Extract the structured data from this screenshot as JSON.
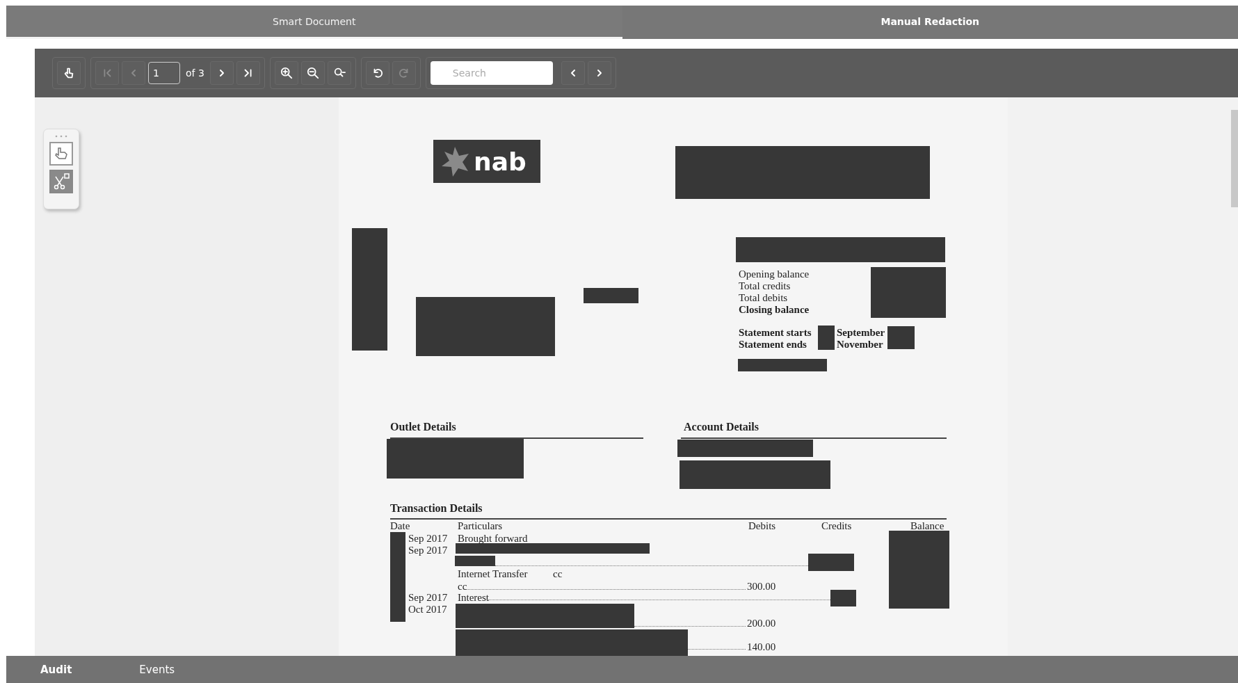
{
  "tabs": [
    {
      "label": "Smart Document",
      "selected": false
    },
    {
      "label": "Manual Redaction",
      "selected": true
    }
  ],
  "toolbar": {
    "groups": [
      [
        {
          "kind": "button",
          "disabled": false
        }
      ],
      [
        {
          "kind": "button",
          "disabled": true
        },
        {
          "kind": "button",
          "disabled": true
        },
        {
          "kind": "page-field",
          "value": "1"
        },
        {
          "kind": "page-count",
          "text": "of 3"
        },
        {
          "kind": "button",
          "disabled": false
        },
        {
          "kind": "button",
          "disabled": false
        }
      ],
      [
        {
          "kind": "button",
          "disabled": false
        },
        {
          "kind": "button",
          "disabled": false
        },
        {
          "kind": "button",
          "disabled": false
        }
      ],
      [
        {
          "kind": "button",
          "disabled": false
        },
        {
          "kind": "button",
          "disabled": true
        }
      ],
      [
        {
          "kind": "search",
          "placeholder": "Search"
        },
        {
          "kind": "button",
          "disabled": false
        },
        {
          "kind": "button",
          "disabled": false
        }
      ]
    ]
  },
  "tool_palette": [
    {
      "selected": false
    },
    {
      "selected": true
    }
  ],
  "document": {
    "logo": "nab",
    "summary": [
      {
        "label": "Opening balance",
        "bold": false
      },
      {
        "label": "Total credits",
        "bold": false
      },
      {
        "label": "Total debits",
        "bold": false
      },
      {
        "label": "Closing balance",
        "bold": true
      }
    ],
    "period": [
      {
        "label": "Statement starts",
        "month": "September"
      },
      {
        "label": "Statement ends",
        "month": "November"
      }
    ],
    "outlet_title": "Outlet Details",
    "account_title": "Account Details",
    "transaction_title": "Transaction Details",
    "columns": [
      "Date",
      "Particulars",
      "Debits",
      "Credits",
      "Balance"
    ],
    "transactions": [
      {
        "date": "Sep 2017",
        "particulars": "Brought forward"
      },
      {
        "date": "Sep 2017"
      },
      {
        "particulars": "Internet Transfer",
        "note": "cc"
      },
      {
        "particulars": "cc",
        "debit": "300.00"
      },
      {
        "date": "Sep 2017",
        "particulars": "Interest"
      },
      {
        "date": "Oct 2017"
      },
      {
        "debit": "200.00"
      },
      {
        "debit": "140.00"
      }
    ]
  },
  "bottom_tabs": [
    {
      "label": "Audit",
      "selected": true
    },
    {
      "label": "Events",
      "selected": false
    }
  ]
}
